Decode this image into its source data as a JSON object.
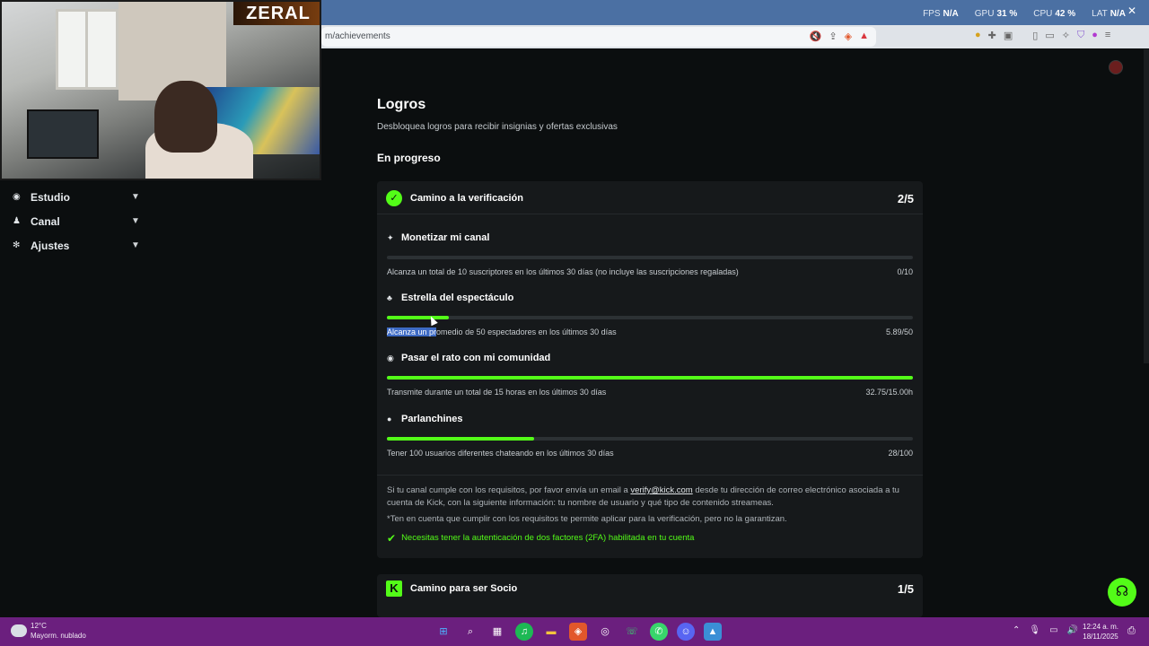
{
  "overlay": {
    "fps_label": "FPS",
    "fps_value": "N/A",
    "gpu_label": "GPU",
    "gpu_value": "31 %",
    "cpu_label": "CPU",
    "cpu_value": "42 %",
    "lat_label": "LAT",
    "lat_value": "N/A"
  },
  "browser": {
    "url": "m/achievements"
  },
  "webcam": {
    "logo": "ZERAL"
  },
  "sidebar": {
    "items": [
      {
        "label": "Estudio",
        "icon": "studio-icon"
      },
      {
        "label": "Canal",
        "icon": "channel-icon"
      },
      {
        "label": "Ajustes",
        "icon": "gear-icon"
      }
    ]
  },
  "page": {
    "title": "Logros",
    "subtitle": "Desbloquea logros para recibir insignias y ofertas exclusivas",
    "section": "En progreso"
  },
  "verification_card": {
    "title": "Camino a la verificación",
    "count": "2/5",
    "achievements": [
      {
        "title": "Monetizar mi canal",
        "icon": "sparkle-icon",
        "desc": "Alcanza un total de 10 suscriptores en los últimos 30 días (no incluye las suscripciones regaladas)",
        "value": "0/10",
        "progress": 0.0
      },
      {
        "title": "Estrella del espectáculo",
        "icon": "users-icon",
        "desc_selected": "Alcanza un pr",
        "desc_rest": "omedio de 50 espectadores en los últimos 30 días",
        "value": "5.89/50",
        "progress": 0.118
      },
      {
        "title": "Pasar el rato con mi comunidad",
        "icon": "broadcast-icon",
        "desc": "Transmite durante un total de 15 horas en los últimos 30 días",
        "value": "32.75/15.00h",
        "progress": 1.0
      },
      {
        "title": "Parlanchines",
        "icon": "chat-icon",
        "desc": "Tener 100 usuarios diferentes chateando en los últimos 30 días",
        "value": "28/100",
        "progress": 0.28
      }
    ],
    "info_before": "Si tu canal cumple con los requisitos, por favor envía un email a ",
    "info_email": "verify@kick.com",
    "info_after": " desde tu dirección de correo electrónico asociada a tu cuenta de Kick, con la siguiente información: tu nombre de usuario y qué tipo de contenido streameas.",
    "note": "*Ten en cuenta que cumplir con los requisitos te permite aplicar para la verificación, pero no la garantizan.",
    "check": "Necesitas tener la autenticación de dos factores (2FA) habilitada en tu cuenta"
  },
  "partner_card": {
    "title": "Camino para ser Socio",
    "count": "1/5"
  },
  "taskbar": {
    "temp": "12°C",
    "weather": "Mayorm. nublado",
    "time": "12:24 a. m.",
    "date": "18/11/2025"
  },
  "colors": {
    "accent": "#53fc18",
    "background": "#0b0e0f",
    "card": "#16191b",
    "taskbar": "#6b1f7e"
  }
}
